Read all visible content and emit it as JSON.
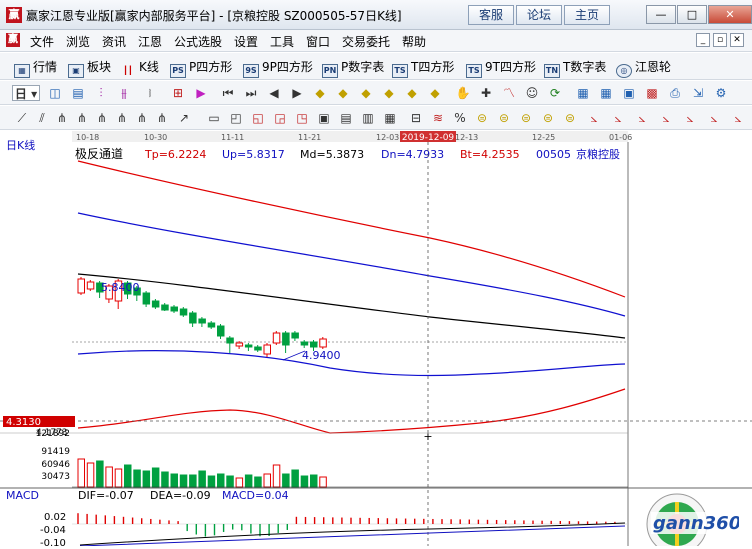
{
  "window": {
    "title": "赢家江恩专业版[赢家内部服务平台] - [京粮控股  SZ000505-57日K线]",
    "app_icon": "赢",
    "links": [
      "客服",
      "论坛",
      "主页"
    ],
    "controls": {
      "minimize": "—",
      "restore": "□",
      "close": "✕"
    }
  },
  "menu": {
    "items": [
      "文件",
      "浏览",
      "资讯",
      "江恩",
      "公式选股",
      "设置",
      "工具",
      "窗口",
      "交易委托",
      "帮助"
    ],
    "mdi_controls": [
      "_",
      "▫",
      "✕"
    ]
  },
  "toolbar1": {
    "items": [
      {
        "label": "行情",
        "icon": "grid-icon"
      },
      {
        "label": "板块",
        "icon": "block-icon"
      },
      {
        "label": "K线",
        "icon": "kline-icon"
      },
      {
        "label": "P四方形",
        "icon": "p-square-icon",
        "badge": "PS"
      },
      {
        "label": "9P四方形",
        "icon": "9p-square-icon",
        "badge": "9S"
      },
      {
        "label": "P数字表",
        "icon": "p-table-icon",
        "badge": "PN"
      },
      {
        "label": "T四方形",
        "icon": "t-square-icon",
        "badge": "TS"
      },
      {
        "label": "9T四方形",
        "icon": "9t-square-icon",
        "badge": "TS"
      },
      {
        "label": "T数字表",
        "icon": "t-table-icon",
        "badge": "TN"
      },
      {
        "label": "江恩轮",
        "icon": "gann-wheel-icon",
        "badge": "◎"
      }
    ]
  },
  "toolbar2": {
    "period_selector": "日"
  },
  "chart": {
    "period_label": "日K线",
    "indicator_name": "极反通道",
    "tp": "Tp=6.2224",
    "up": "Up=5.8317",
    "md": "Md=5.3873",
    "dn": "Dn=4.7933",
    "bt": "Bt=4.2535",
    "code_label": "00505",
    "stock_name": "京粮控股",
    "date_labels": [
      "10-18",
      "10-30",
      "11-11",
      "11-21",
      "12-03",
      "12-13",
      "12-25",
      "01-06"
    ],
    "cursor_date": "2019-12-09",
    "high_label": "5.8400",
    "low_label": "4.9400",
    "cursor_price": "4.3130",
    "price_axis_partial": "4.1773",
    "volume_axis": [
      "121892",
      "91419",
      "60946",
      "30473"
    ],
    "colors": {
      "up": "#e60000",
      "down": "#00a040",
      "upper_band": "#e00000",
      "mid_band": "#1010d0",
      "center": "#000000"
    }
  },
  "macd": {
    "name": "MACD",
    "dif": "DIF=-0.07",
    "dea": "DEA=-0.09",
    "macd": "MACD=0.04",
    "axis": [
      "0.02",
      "-0.04",
      "-0.10"
    ]
  },
  "watermark": {
    "text": "gann360"
  }
}
